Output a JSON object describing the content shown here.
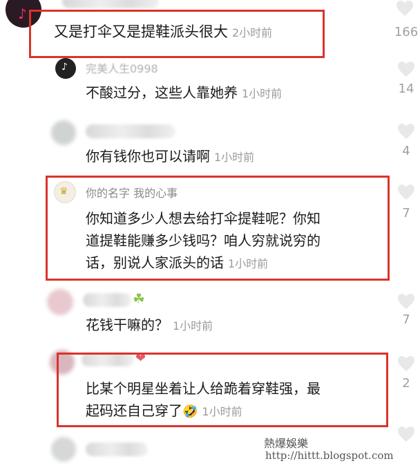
{
  "comments": [
    {
      "text": "又是打伞又是提鞋派头很大",
      "time": "2小时前",
      "likes": "166"
    },
    {
      "user": "完美人生0998",
      "text": "不酸过分，这些人靠她养",
      "time": "1小时前",
      "likes": "14"
    },
    {
      "text": "你有钱你也可以请啊",
      "time": "1小时前",
      "likes": "4"
    },
    {
      "user": "你的名字 我的心事",
      "lines": [
        "你知道多少人想去给打伞提鞋呢？你知",
        "道提鞋能赚多少钱吗？咱人穷就说穷的",
        "话，别说人家派头的话"
      ],
      "time": "1小时前",
      "likes": "7"
    },
    {
      "text": "花钱干嘛的？",
      "time": "1小时前",
      "likes": "7"
    },
    {
      "lines": [
        "比某个明星坐着让人给跪着穿鞋强，最",
        "起码还自己穿了"
      ],
      "emoji": "🤣",
      "time": "1小时前",
      "likes": "2"
    }
  ],
  "watermark": {
    "title": "熱爆娛樂",
    "url": "http://hittt.blogspot.com"
  },
  "colors": {
    "highlight": "#d9342b",
    "heart": "#e8e8e8",
    "muted": "#9a9a9a"
  }
}
